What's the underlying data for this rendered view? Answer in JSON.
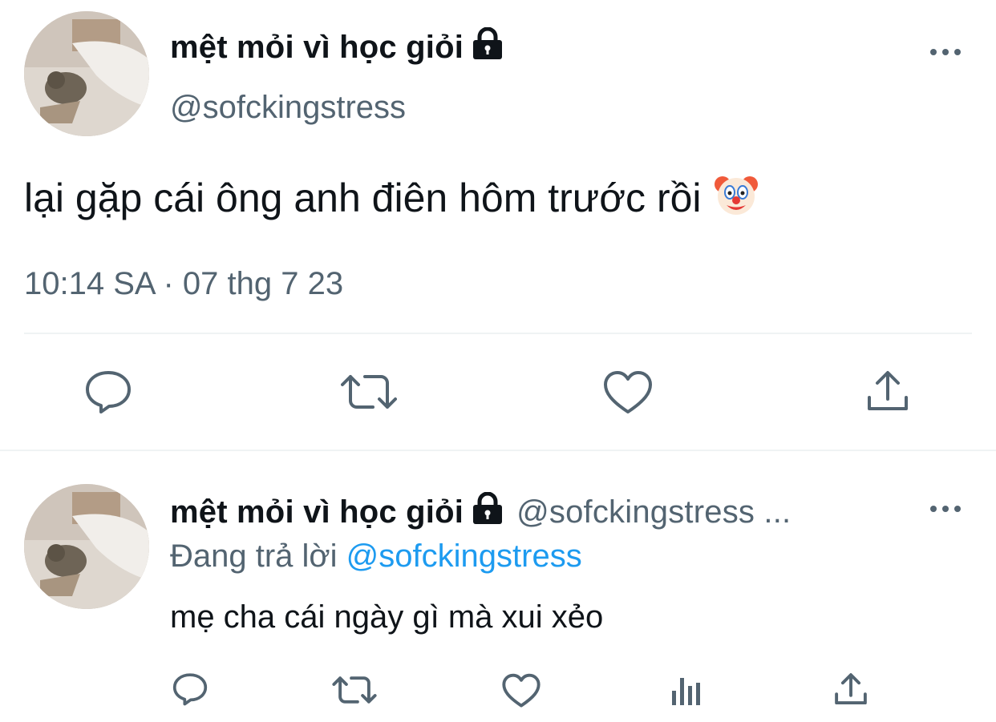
{
  "main_tweet": {
    "display_name": "mệt mỏi vì học giỏi",
    "handle": "@sofckingstress",
    "text": "lại gặp cái ông anh điên hôm trước rồi",
    "emoji": "clown-face-emoji",
    "timestamp": "10:14 SA · 07 thg 7 23",
    "protected": true,
    "actions": [
      "reply-icon",
      "retweet-icon",
      "like-icon",
      "share-icon"
    ]
  },
  "reply_tweet": {
    "display_name": "mệt mỏi vì học giỏi",
    "handle": "@sofckingstress ...",
    "replying_to_label": "Đang trả lời",
    "replying_to_handle": "@sofckingstress",
    "text": "mẹ cha cái ngày gì mà xui xẻo",
    "protected": true,
    "actions": [
      "reply-icon",
      "retweet-icon",
      "like-icon",
      "analytics-icon",
      "share-icon"
    ]
  },
  "colors": {
    "text_primary": "#0f1419",
    "text_secondary": "#536471",
    "link": "#1d9bf0",
    "divider": "#eff3f4"
  }
}
